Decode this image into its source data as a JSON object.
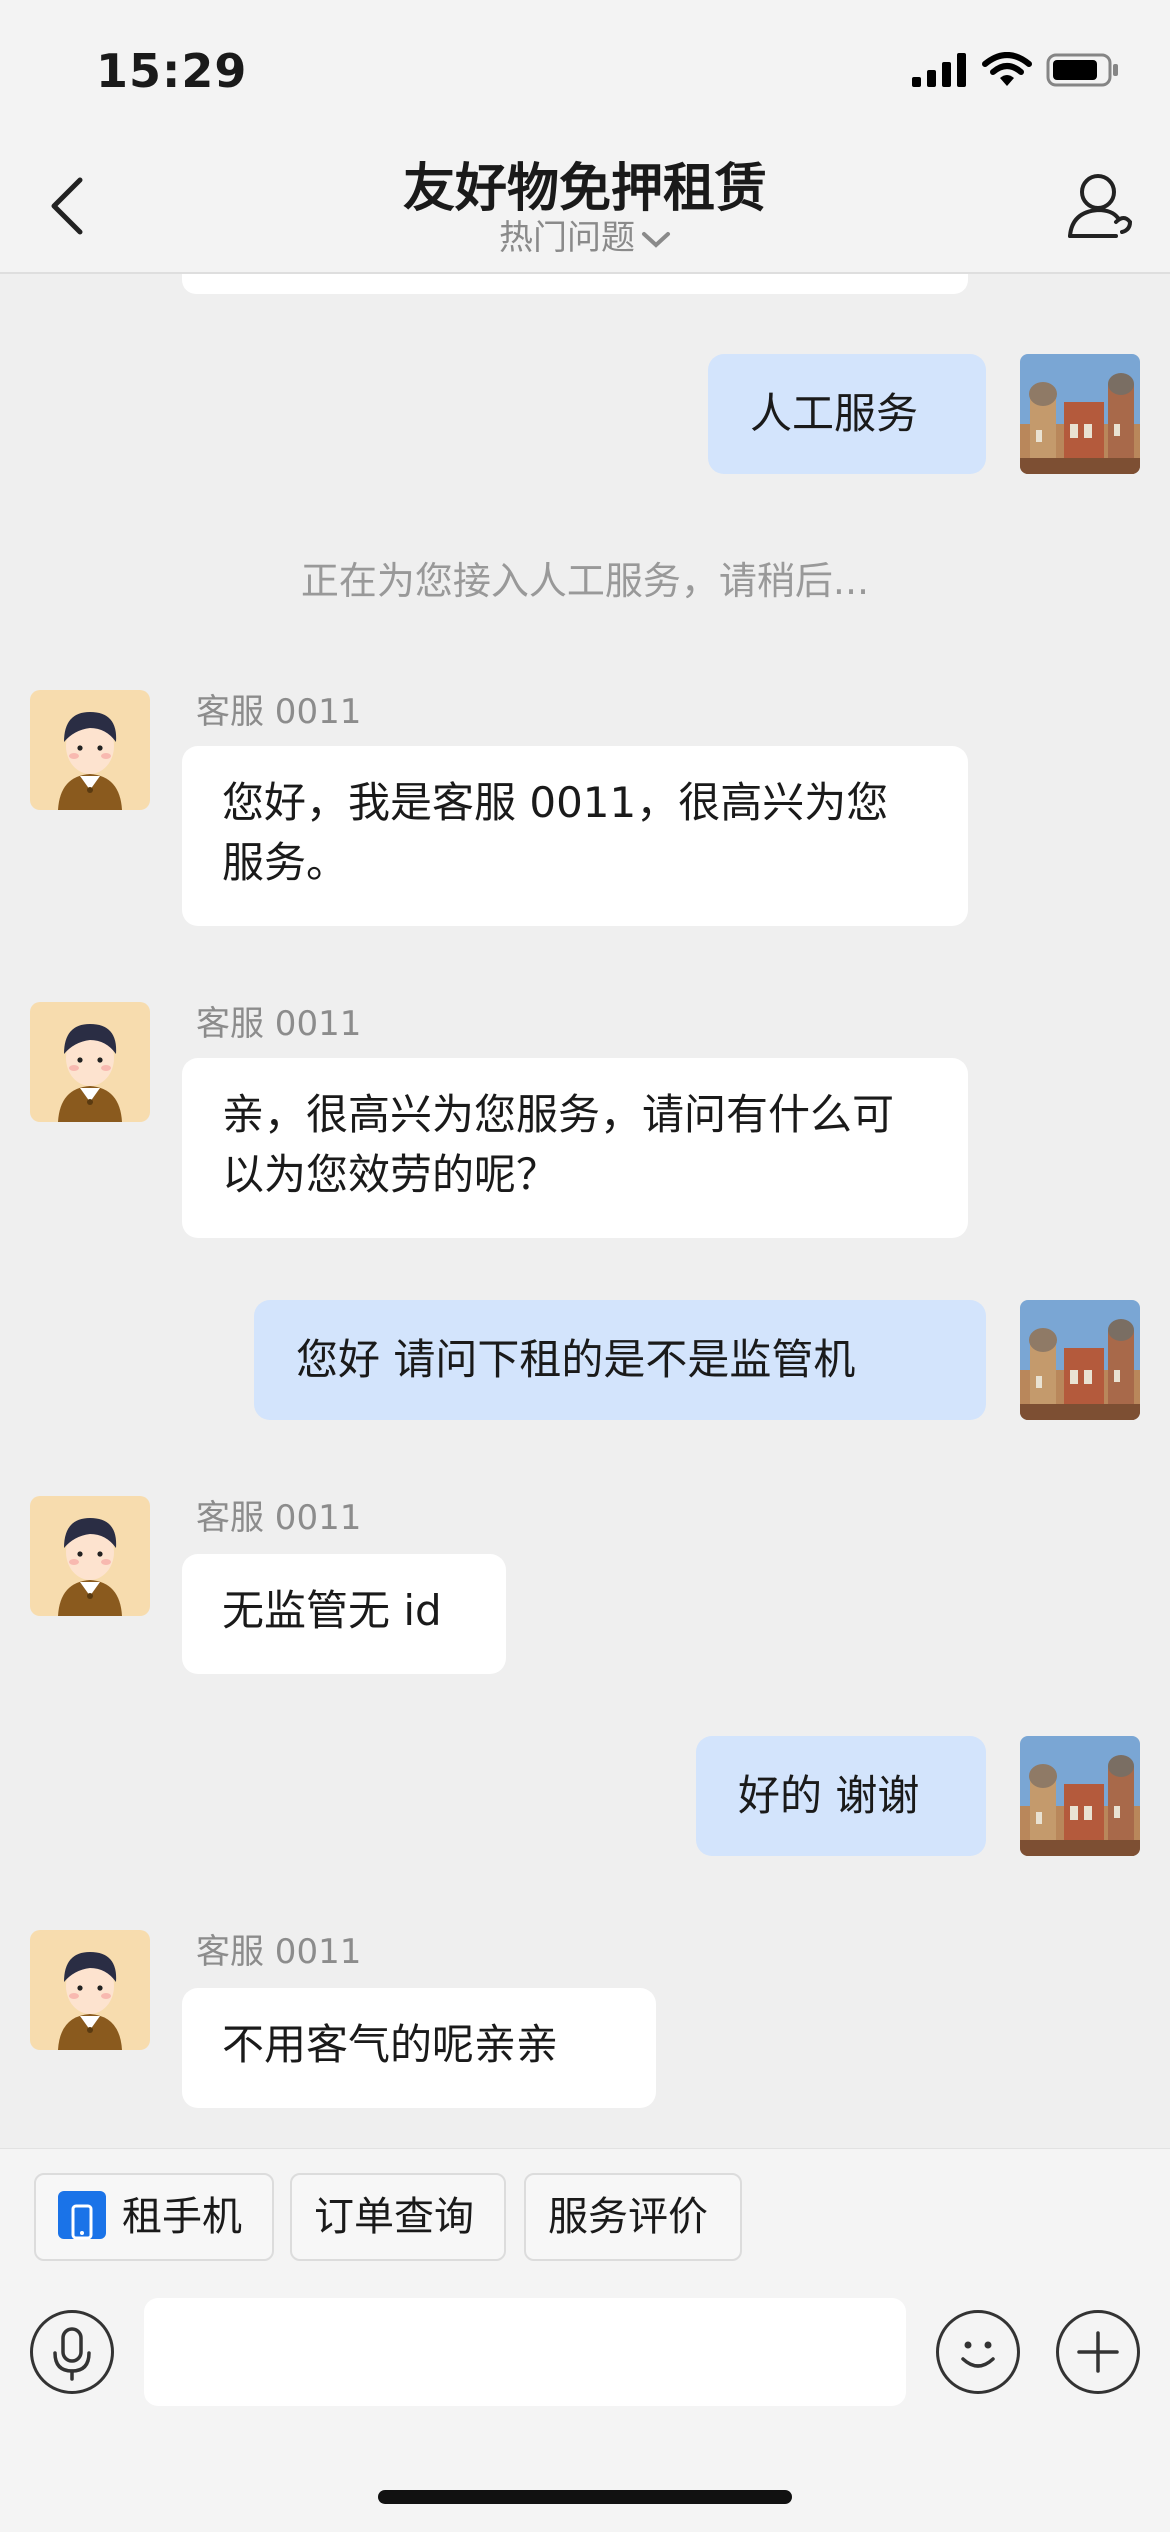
{
  "status": {
    "time": "15:29"
  },
  "header": {
    "title": "友好物免押租赁",
    "subtitle": "热门问题"
  },
  "messages": [
    {
      "text": "人工服务"
    },
    {
      "text": "正在为您接入人工服务，请稍后..."
    },
    {
      "sender": "客服 0011",
      "text": "您好，我是客服 0011，很高兴为您服务。"
    },
    {
      "sender": "客服 0011",
      "text": "亲，很高兴为您服务，请问有什么可以为您效劳的呢？"
    },
    {
      "text": "您好 请问下租的是不是监管机"
    },
    {
      "sender": "客服 0011",
      "text": "无监管无 id"
    },
    {
      "text": "好的 谢谢"
    },
    {
      "sender": "客服 0011",
      "text": "不用客气的呢亲亲"
    }
  ],
  "quick_actions": [
    {
      "label": "租手机",
      "icon": "phone-icon"
    },
    {
      "label": "订单查询"
    },
    {
      "label": "服务评价"
    }
  ],
  "input": {
    "value": ""
  }
}
